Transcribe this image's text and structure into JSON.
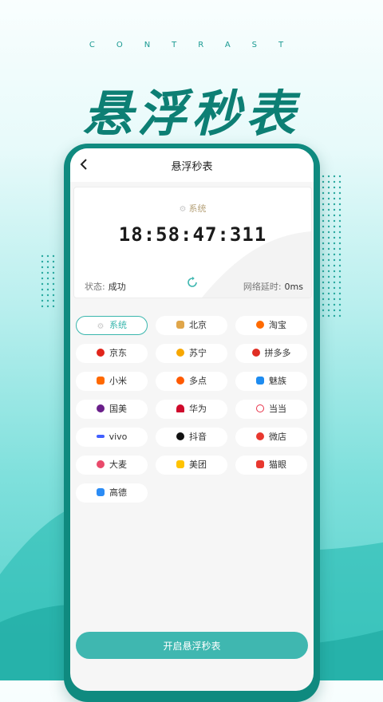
{
  "header": {
    "contrast": "CONTRAST",
    "title": "悬浮秒表"
  },
  "nav": {
    "title": "悬浮秒表",
    "back_icon": "chevron-left-icon"
  },
  "clock_card": {
    "source": "系统",
    "time": "18:58:47:311",
    "status_label": "状态:",
    "status_value": "成功",
    "latency_label": "网络延时:",
    "latency_value": "0ms"
  },
  "platforms": [
    {
      "label": "系统",
      "icon": "gear-icon",
      "color": "#c9c9c9",
      "active": true
    },
    {
      "label": "北京",
      "icon": "beijing-icon",
      "color": "#e0a64a"
    },
    {
      "label": "淘宝",
      "icon": "taobao-icon",
      "color": "#ff6a00"
    },
    {
      "label": "京东",
      "icon": "jd-icon",
      "color": "#e1251b"
    },
    {
      "label": "苏宁",
      "icon": "suning-icon",
      "color": "#f7a700"
    },
    {
      "label": "拼多多",
      "icon": "pinduoduo-icon",
      "color": "#e02e24"
    },
    {
      "label": "小米",
      "icon": "xiaomi-icon",
      "color": "#ff6900"
    },
    {
      "label": "多点",
      "icon": "duodian-icon",
      "color": "#ff5a00"
    },
    {
      "label": "魅族",
      "icon": "meizu-icon",
      "color": "#1e8cf0"
    },
    {
      "label": "国美",
      "icon": "gome-icon",
      "color": "#6a1f8a"
    },
    {
      "label": "华为",
      "icon": "huawei-icon",
      "color": "#cf0a2c"
    },
    {
      "label": "当当",
      "icon": "dangdang-icon",
      "color": "#e8334a"
    },
    {
      "label": "vivo",
      "icon": "vivo-icon",
      "color": "#415fff"
    },
    {
      "label": "抖音",
      "icon": "douyin-icon",
      "color": "#111111"
    },
    {
      "label": "微店",
      "icon": "weidian-icon",
      "color": "#e8382f"
    },
    {
      "label": "大麦",
      "icon": "damai-icon",
      "color": "#e94a6b"
    },
    {
      "label": "美团",
      "icon": "meituan-icon",
      "color": "#ffc300"
    },
    {
      "label": "猫眼",
      "icon": "maoyan-icon",
      "color": "#e8382f"
    },
    {
      "label": "高德",
      "icon": "gaode-icon",
      "color": "#2b8cf5"
    }
  ],
  "start_button": {
    "label": "开启悬浮秒表"
  },
  "colors": {
    "accent": "#3fb7b0",
    "title": "#0d7f74",
    "frame": "#0f8a7f"
  }
}
